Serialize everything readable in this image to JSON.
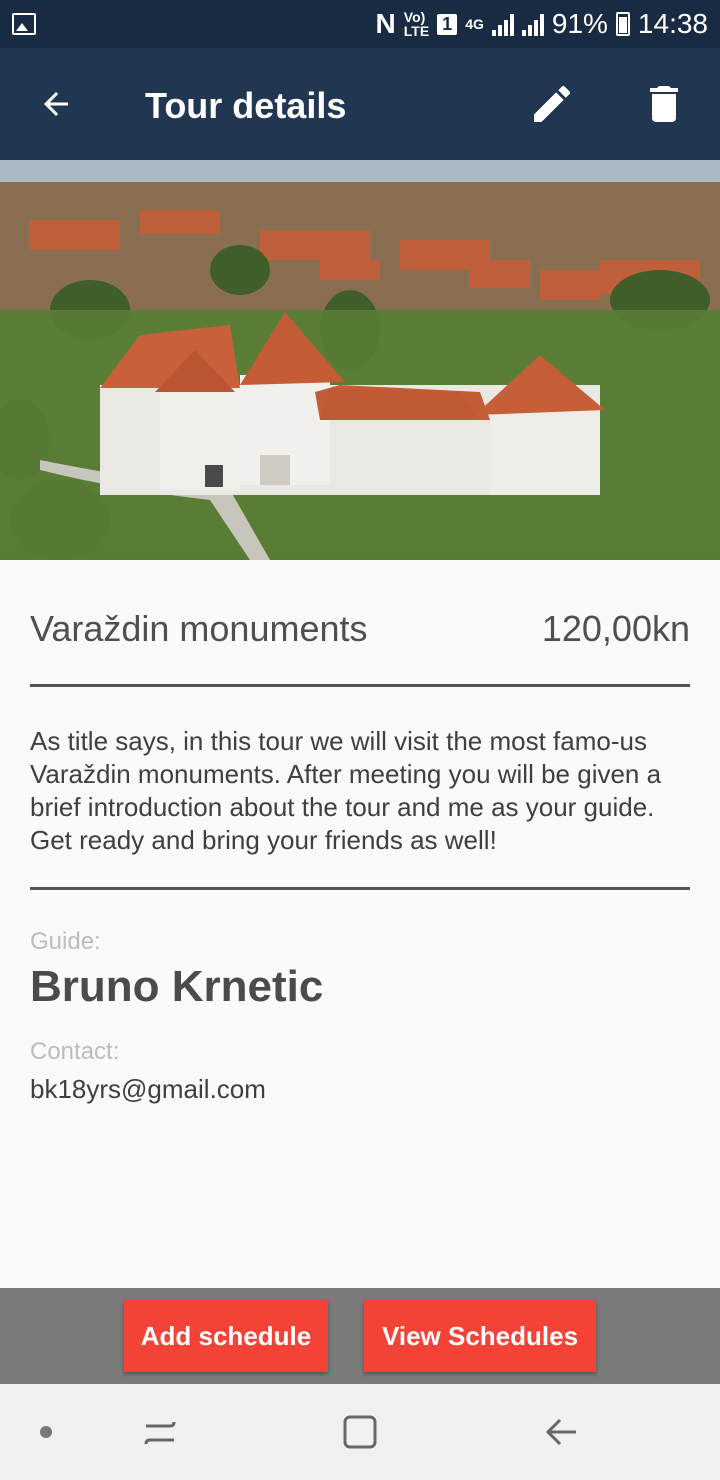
{
  "status_bar": {
    "lte_label": "LTE",
    "volte_label": "Vo)",
    "sim_badge": "1",
    "network": "4G",
    "battery_percent": "91%",
    "time": "14:38"
  },
  "app_bar": {
    "title": "Tour details",
    "back_icon": "arrow-back-icon",
    "edit_icon": "pencil-icon",
    "delete_icon": "trash-icon"
  },
  "hero": {
    "image": "castle-aerial-photo"
  },
  "tour": {
    "name": "Varaždin monuments",
    "price": "120,00kn",
    "description": "As title says, in this tour we will visit the most famo-us Varaždin monuments. After meeting you will be given a brief introduction about the tour and me as your guide. Get ready and bring your friends as well!"
  },
  "guide": {
    "label": "Guide:",
    "name": "Bruno Krnetic",
    "contact_label": "Contact:",
    "contact": "bk18yrs@gmail.com"
  },
  "actions": {
    "add_schedule": "Add schedule",
    "view_schedules": "View Schedules"
  },
  "nav": {
    "dot": "dot-icon",
    "recent": "recent-apps-icon",
    "home": "home-icon",
    "back": "back-icon"
  },
  "colors": {
    "status_bar": "#182b43",
    "app_bar": "#203651",
    "accent_button": "#f44336",
    "action_bar": "#7b7b7b"
  }
}
